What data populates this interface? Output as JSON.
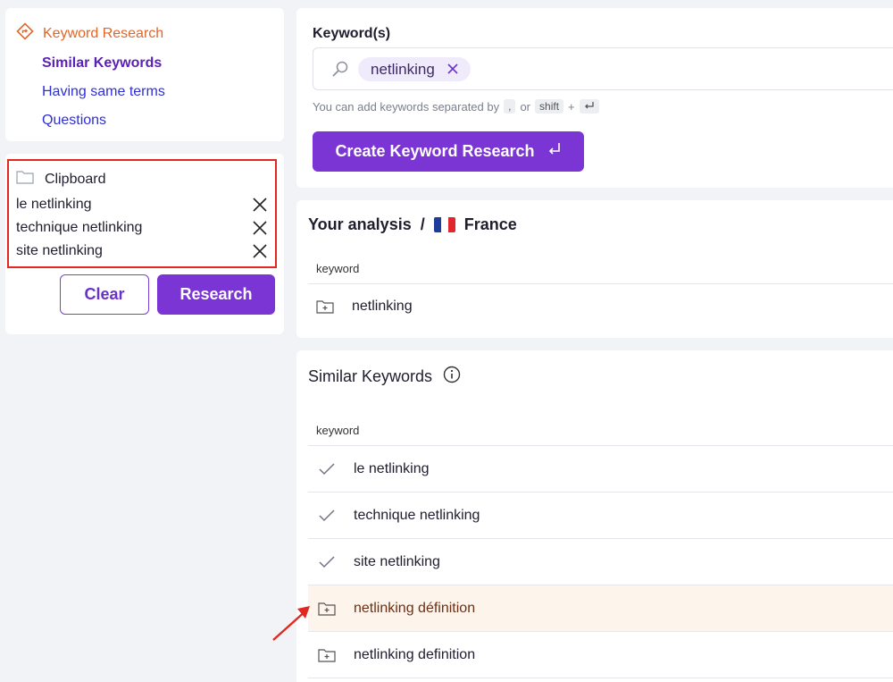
{
  "nav": {
    "header": "Keyword Research",
    "items": [
      "Similar Keywords",
      "Having same terms",
      "Questions"
    ]
  },
  "clipboard": {
    "title": "Clipboard",
    "items": [
      "le netlinking",
      "technique netlinking",
      "site netlinking"
    ],
    "clear_label": "Clear",
    "research_label": "Research"
  },
  "keyword_input": {
    "label": "Keyword(s)",
    "chip": "netlinking",
    "hint_prefix": "You can add keywords separated by",
    "hint_comma": ",",
    "hint_or": "or",
    "hint_shift": "shift",
    "hint_plus": "+",
    "create_label": "Create Keyword Research"
  },
  "analysis": {
    "title": "Your analysis",
    "separator": "/",
    "country": "France",
    "column": "keyword",
    "rows": [
      "netlinking"
    ]
  },
  "similar": {
    "title": "Similar Keywords",
    "column": "keyword",
    "rows": [
      {
        "keyword": "le netlinking",
        "state": "added"
      },
      {
        "keyword": "technique netlinking",
        "state": "added"
      },
      {
        "keyword": "site netlinking",
        "state": "added"
      },
      {
        "keyword": "netlinking définition",
        "state": "addable"
      },
      {
        "keyword": "netlinking definition",
        "state": "addable"
      }
    ]
  },
  "colors": {
    "accent": "#7b35d4",
    "nav_header": "#e0662a",
    "highlight_border": "#e3281f",
    "row_highlight": "#fdf5ec"
  }
}
